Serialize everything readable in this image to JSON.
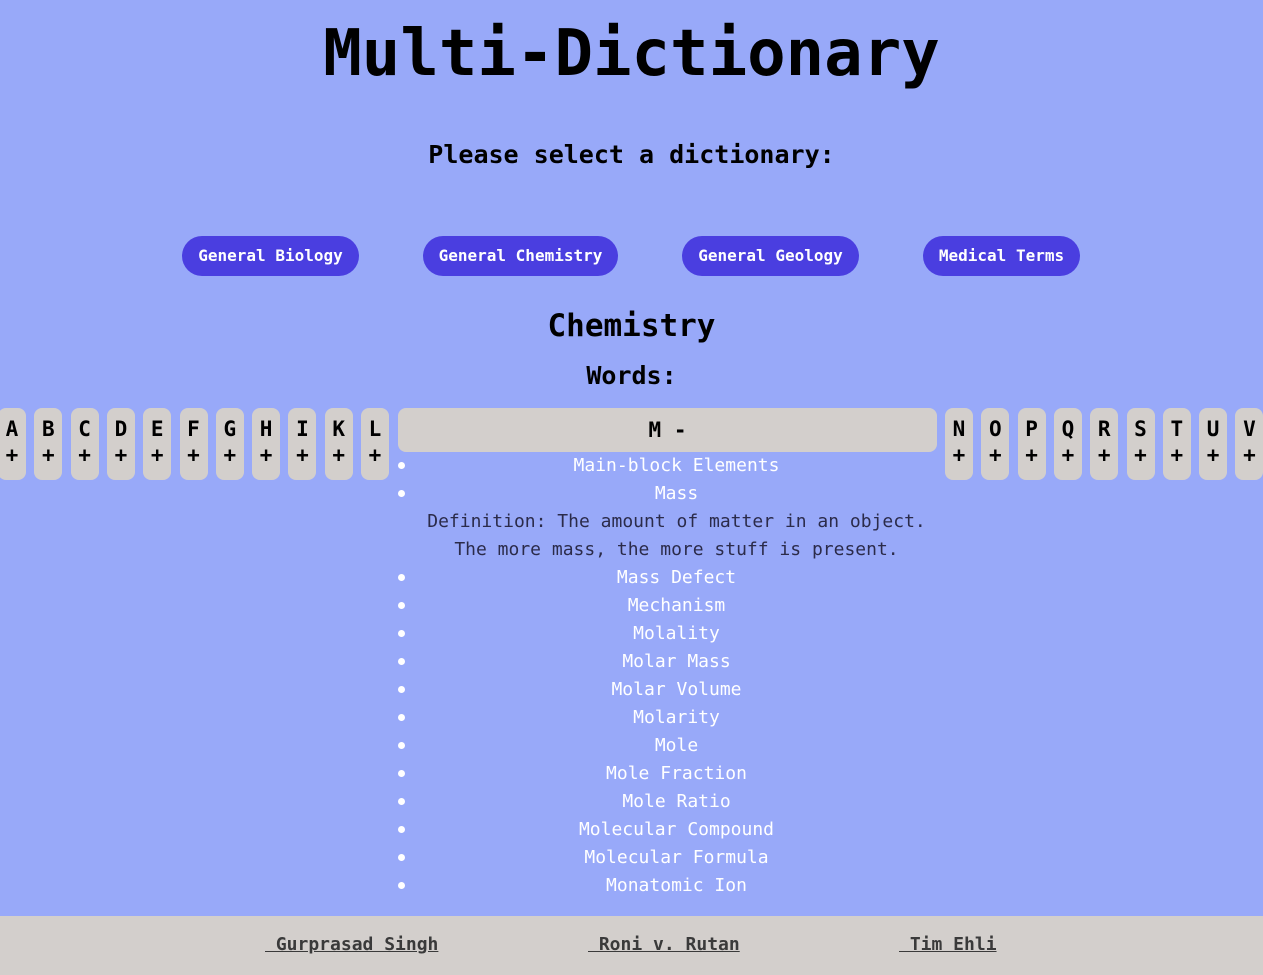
{
  "header": {
    "title": "Multi-Dictionary",
    "prompt": "Please select a dictionary:"
  },
  "dictionaries": [
    {
      "label": "General Biology"
    },
    {
      "label": "General Chemistry"
    },
    {
      "label": "General Geology"
    },
    {
      "label": "Medical Terms"
    }
  ],
  "main": {
    "subject": "Chemistry",
    "words_heading": "Words:"
  },
  "letters_before": [
    {
      "letter": "A",
      "toggle": "+"
    },
    {
      "letter": "B",
      "toggle": "+"
    },
    {
      "letter": "C",
      "toggle": "+"
    },
    {
      "letter": "D",
      "toggle": "+"
    },
    {
      "letter": "E",
      "toggle": "+"
    },
    {
      "letter": "F",
      "toggle": "+"
    },
    {
      "letter": "G",
      "toggle": "+"
    },
    {
      "letter": "H",
      "toggle": "+"
    },
    {
      "letter": "I",
      "toggle": "+"
    },
    {
      "letter": "K",
      "toggle": "+"
    },
    {
      "letter": "L",
      "toggle": "+"
    }
  ],
  "open_letter": {
    "label": "M -"
  },
  "letters_after": [
    {
      "letter": "N",
      "toggle": "+"
    },
    {
      "letter": "O",
      "toggle": "+"
    },
    {
      "letter": "P",
      "toggle": "+"
    },
    {
      "letter": "Q",
      "toggle": "+"
    },
    {
      "letter": "R",
      "toggle": "+"
    },
    {
      "letter": "S",
      "toggle": "+"
    },
    {
      "letter": "T",
      "toggle": "+"
    },
    {
      "letter": "U",
      "toggle": "+"
    },
    {
      "letter": "V",
      "toggle": "+"
    }
  ],
  "words": [
    {
      "word": "Main-block Elements"
    },
    {
      "word": "Mass",
      "definition": [
        "Definition: The amount of matter in an object.",
        "The more mass, the more stuff is present."
      ]
    },
    {
      "word": "Mass Defect"
    },
    {
      "word": "Mechanism"
    },
    {
      "word": "Molality"
    },
    {
      "word": "Molar Mass"
    },
    {
      "word": "Molar Volume"
    },
    {
      "word": "Molarity"
    },
    {
      "word": "Mole"
    },
    {
      "word": "Mole Fraction"
    },
    {
      "word": "Mole Ratio"
    },
    {
      "word": "Molecular Compound"
    },
    {
      "word": "Molecular Formula"
    },
    {
      "word": "Monatomic Ion"
    }
  ],
  "footer": {
    "authors": [
      " Gurprasad Singh",
      " Roni v. Rutan",
      " Tim Ehli"
    ]
  }
}
